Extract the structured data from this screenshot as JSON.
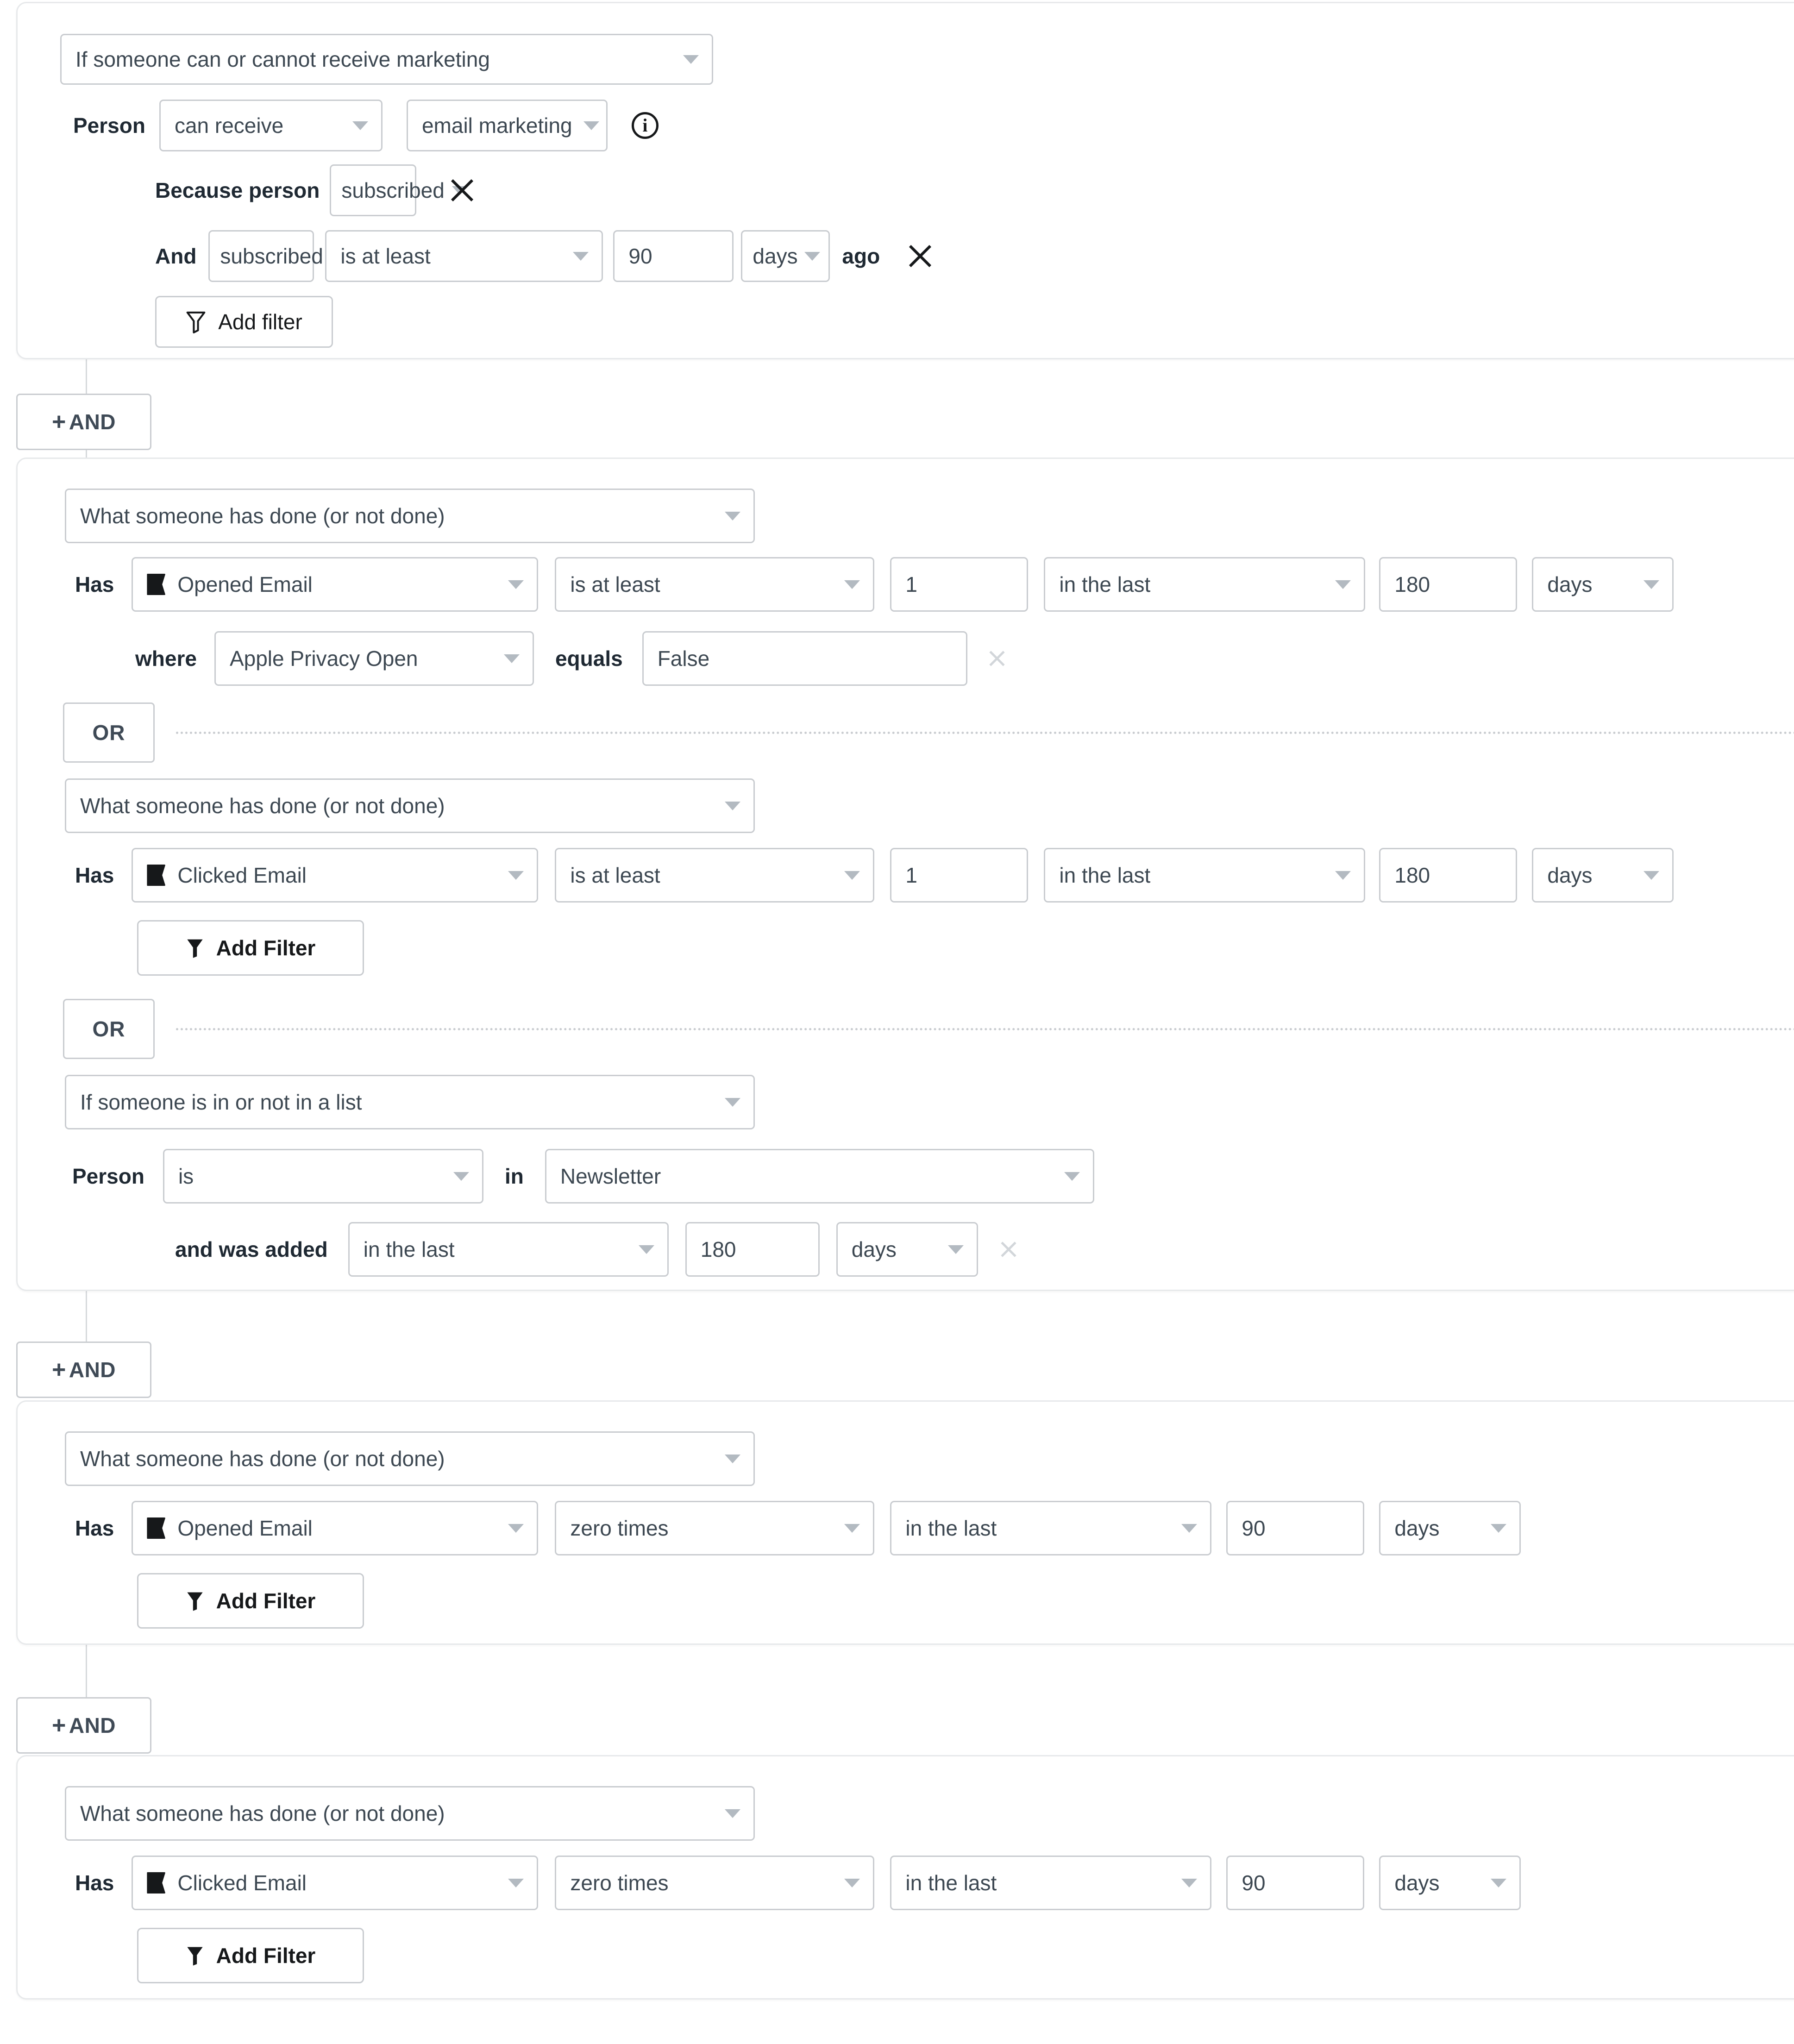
{
  "colors": {
    "border": "#c9ccd0",
    "card_border": "#e7e9eb",
    "text": "#1f2933",
    "muted": "#b3bac1",
    "icon_dark": "#16181a"
  },
  "blocks": [
    {
      "id": "block-marketing",
      "trigger": "If someone can or cannot receive marketing",
      "person_label": "Person",
      "person_op": "can receive",
      "person_channel": "email marketing",
      "info_icon": "info-circle-icon",
      "because_label": "Because person",
      "because_value": "subscribed",
      "because_remove": "close-icon",
      "and_label": "And",
      "and_field": "subscribed date",
      "and_operator": "is at least",
      "and_value": "90",
      "and_unit": "days",
      "and_suffix": "ago",
      "and_remove": "close-icon",
      "add_filter": "Add filter"
    },
    {
      "id": "block-engaged",
      "rules": [
        {
          "trigger": "What someone has done (or not done)",
          "has_label": "Has",
          "metric": "Opened Email",
          "operator": "is at least",
          "count": "1",
          "timeframe": "in the last",
          "duration": "180",
          "unit": "days",
          "where_label": "where",
          "where_field": "Apple Privacy Open",
          "equals_label": "equals",
          "equals_value": "False",
          "where_remove": "close-icon"
        },
        {
          "or_label": "OR",
          "trigger": "What someone has done (or not done)",
          "has_label": "Has",
          "metric": "Clicked Email",
          "operator": "is at least",
          "count": "1",
          "timeframe": "in the last",
          "duration": "180",
          "unit": "days",
          "add_filter": "Add Filter"
        },
        {
          "or_label": "OR",
          "trigger": "If someone is in or not in a list",
          "person_label": "Person",
          "person_op": "is",
          "in_label": "in",
          "list_name": "Newsletter",
          "added_label": "and was added",
          "added_timeframe": "in the last",
          "added_duration": "180",
          "added_unit": "days",
          "added_remove": "close-icon"
        }
      ]
    },
    {
      "id": "block-no-opens",
      "trigger": "What someone has done (or not done)",
      "has_label": "Has",
      "metric": "Opened Email",
      "operator": "zero times",
      "timeframe": "in the last",
      "duration": "90",
      "unit": "days",
      "add_filter": "Add Filter"
    },
    {
      "id": "block-no-clicks",
      "trigger": "What someone has done (or not done)",
      "has_label": "Has",
      "metric": "Clicked Email",
      "operator": "zero times",
      "timeframe": "in the last",
      "duration": "90",
      "unit": "days",
      "add_filter": "Add Filter"
    }
  ],
  "connectors": [
    {
      "label": "AND",
      "plus": "+"
    },
    {
      "label": "AND",
      "plus": "+"
    },
    {
      "label": "AND",
      "plus": "+"
    }
  ]
}
